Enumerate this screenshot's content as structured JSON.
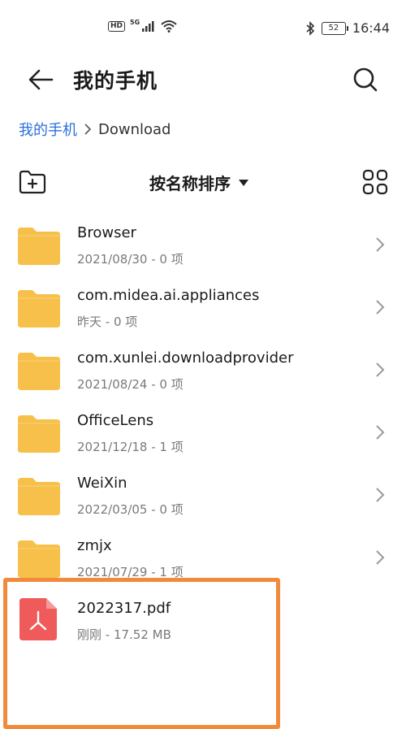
{
  "status": {
    "time": "16:44",
    "battery": "52",
    "hd_label": "HD",
    "network_label": "5G"
  },
  "header": {
    "title": "我的手机"
  },
  "breadcrumb": {
    "root": "我的手机",
    "current": "Download"
  },
  "toolbar": {
    "sort_label": "按名称排序"
  },
  "items": [
    {
      "name": "Browser",
      "meta": "2021/08/30 - 0 项",
      "type": "folder"
    },
    {
      "name": "com.midea.ai.appliances",
      "meta": "昨天 - 0 项",
      "type": "folder"
    },
    {
      "name": "com.xunlei.downloadprovider",
      "meta": "2021/08/24 - 0 项",
      "type": "folder"
    },
    {
      "name": "OfficeLens",
      "meta": "2021/12/18 - 1 项",
      "type": "folder"
    },
    {
      "name": "WeiXin",
      "meta": "2022/03/05 - 0 项",
      "type": "folder"
    },
    {
      "name": "zmjx",
      "meta": "2021/07/29 - 1 项",
      "type": "folder"
    },
    {
      "name": "2022317.pdf",
      "meta": "刚刚 - 17.52 MB",
      "type": "pdf"
    }
  ],
  "colors": {
    "accent": "#2a6fdb",
    "folder": "#f7c04a",
    "pdf": "#ef5b5b",
    "highlight": "#f28a3c"
  }
}
